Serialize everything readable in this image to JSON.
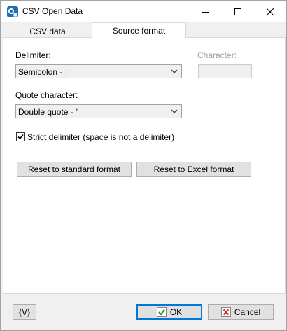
{
  "window": {
    "title": "CSV Open Data",
    "icon": "csv-app-icon"
  },
  "titlebar_buttons": {
    "minimize_icon": "minimize-icon",
    "maximize_icon": "maximize-icon",
    "close_icon": "close-icon"
  },
  "tabs": [
    {
      "label": "CSV data",
      "active": false
    },
    {
      "label": "Source format",
      "active": true
    }
  ],
  "form": {
    "delimiter_label": "Delimiter:",
    "delimiter_value": "Semicolon - ;",
    "character_label": "Character:",
    "character_value": "",
    "quote_label": "Quote character:",
    "quote_value": "Double quote - \"",
    "strict_label": "Strict delimiter (space is not a delimiter)",
    "strict_checked": true
  },
  "buttons": {
    "reset_standard": "Reset to standard format",
    "reset_excel": "Reset to Excel format",
    "variables": "{V}",
    "ok": "OK",
    "cancel": "Cancel"
  },
  "colors": {
    "accent": "#0078d7",
    "ok_check": "#1e8c2d",
    "cancel_x": "#d42222"
  }
}
